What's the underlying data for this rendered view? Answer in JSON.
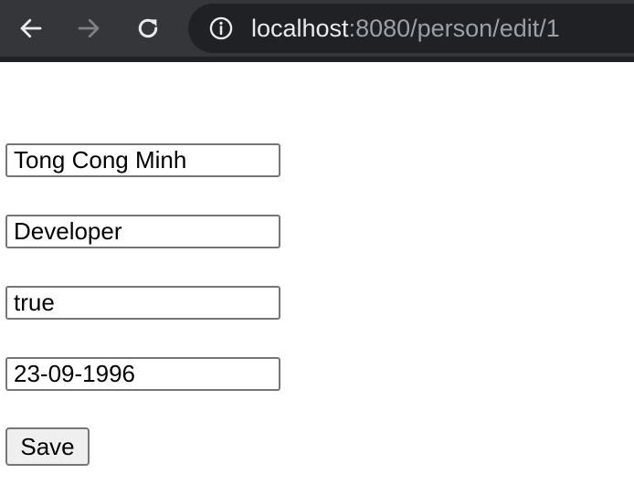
{
  "browser": {
    "back_icon": "arrow-left-icon",
    "forward_icon": "arrow-right-icon",
    "reload_icon": "reload-icon",
    "info_icon": "info-circle-icon",
    "url_host": "localhost",
    "url_rest": ":8080/person/edit/1"
  },
  "form": {
    "name_value": "Tong Cong Minh",
    "job_value": "Developer",
    "active_value": "true",
    "dob_value": "23-09-1996",
    "save_label": "Save"
  }
}
